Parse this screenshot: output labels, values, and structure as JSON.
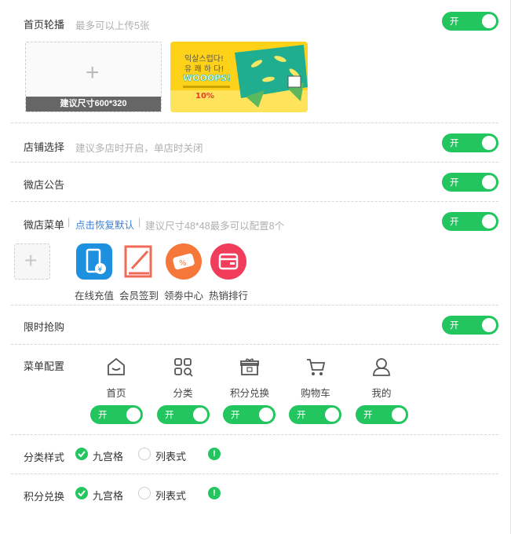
{
  "carousel": {
    "label": "首页轮播",
    "hint": "最多可以上传5张",
    "toggle": "开",
    "upload_caption": "建议尺寸600*320",
    "banner_texts": [
      "익살스럽다!",
      "유 쾌 하 다!",
      "WOOOPS!",
      "10%"
    ]
  },
  "store_select": {
    "label": "店铺选择",
    "hint": "建议多店时开启，单店时关闭",
    "toggle": "开"
  },
  "notice": {
    "label": "微店公告",
    "toggle": "开"
  },
  "menu": {
    "label": "微店菜单",
    "sep": "|",
    "link": "点击恢复默认",
    "hint": "建议尺寸48*48最多可以配置8个",
    "toggle": "开",
    "items": [
      {
        "label": "在线充值",
        "icon": "phone-recharge-icon",
        "color": "#1e90e0"
      },
      {
        "label": "会员签到",
        "icon": "sign-in-icon",
        "color": "#f06a56"
      },
      {
        "label": "领劵中心",
        "icon": "coupon-icon",
        "color": "#f5773a"
      },
      {
        "label": "热销排行",
        "icon": "wallet-icon",
        "color": "#f23c5c"
      }
    ]
  },
  "flash_sale": {
    "label": "限时抢购",
    "toggle": "开"
  },
  "nav_config": {
    "label": "菜单配置",
    "items": [
      {
        "label": "首页",
        "icon": "home-icon",
        "toggle": "开"
      },
      {
        "label": "分类",
        "icon": "category-icon",
        "toggle": "开"
      },
      {
        "label": "积分兑换",
        "icon": "gift-icon",
        "toggle": "开"
      },
      {
        "label": "购物车",
        "icon": "cart-icon",
        "toggle": "开"
      },
      {
        "label": "我的",
        "icon": "user-icon",
        "toggle": "开"
      }
    ]
  },
  "category_style": {
    "label": "分类样式",
    "option_grid": "九宫格",
    "option_list": "列表式",
    "selected": "九宫格"
  },
  "points_style": {
    "label": "积分兑换",
    "option_grid": "九宫格",
    "option_list": "列表式",
    "selected": "九宫格"
  },
  "colors": {
    "accent": "#22c55e",
    "link": "#3f7fd4"
  }
}
